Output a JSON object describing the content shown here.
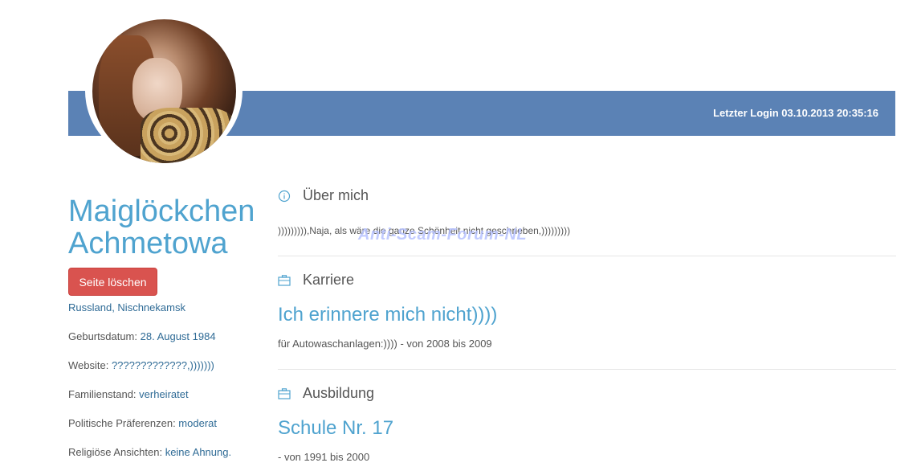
{
  "header": {
    "last_login": "Letzter Login 03.10.2013 20:35:16"
  },
  "profile": {
    "first_name": "Maiglöckchen",
    "last_name": "Achmetowa",
    "delete_button": "Seite löschen",
    "location": "Russland, Nischnekamsk",
    "fields": [
      {
        "label": "Geburtsdatum: ",
        "value": "28. August 1984"
      },
      {
        "label": "Website: ",
        "value": "?????????????,)))))))"
      },
      {
        "label": "Familienstand: ",
        "value": "verheiratet"
      },
      {
        "label": "Politische Präferenzen: ",
        "value": "moderat"
      },
      {
        "label": "Religiöse Ansichten: ",
        "value": "keine Ahnung."
      }
    ]
  },
  "about": {
    "heading": "Über mich",
    "text": "))))))))),Naja, als wäre die ganze Schönheit nicht geschrieben,)))))))))",
    "watermark": "Anti-Scam-Forum-NL"
  },
  "career": {
    "heading": "Karriere",
    "title": "Ich erinnere mich nicht))))",
    "detail": "für Autowaschanlagen:)))) - von 2008 bis 2009"
  },
  "education": {
    "heading": "Ausbildung",
    "title": "Schule Nr. 17",
    "detail": "- von 1991 bis 2000"
  },
  "colors": {
    "banner": "#5b82b5",
    "accent": "#4fa3cf",
    "delete": "#d9534f"
  }
}
